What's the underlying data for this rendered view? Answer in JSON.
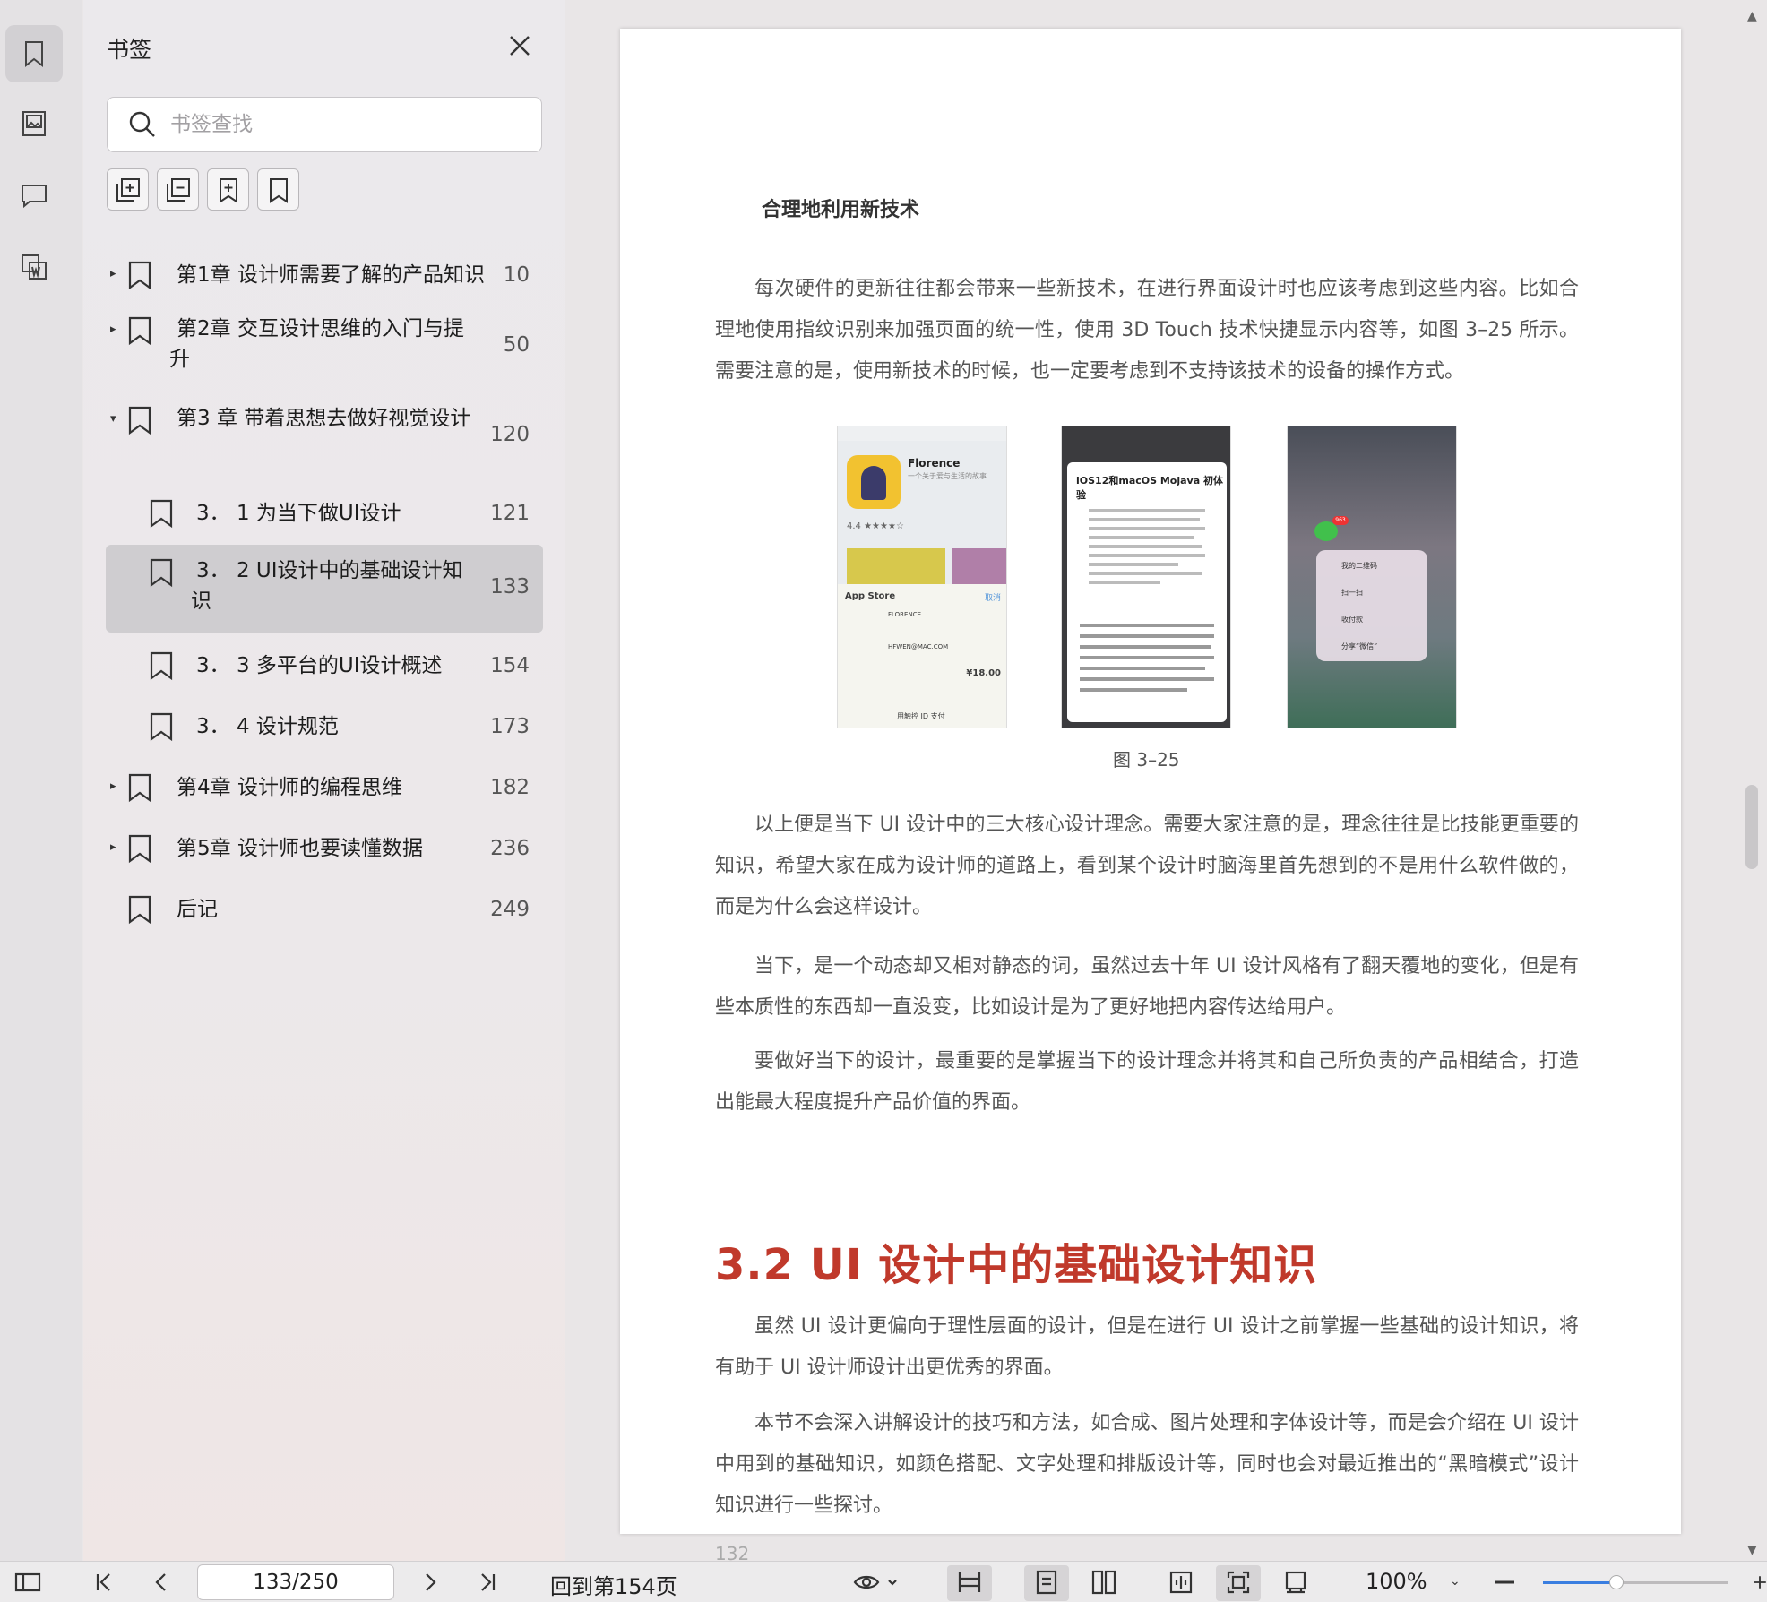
{
  "sidebar_panel": {
    "title": "书签",
    "search_placeholder": "书签查找",
    "bookmarks": [
      {
        "label": "第1章 设计师需要了解的产品知识",
        "page": "10",
        "level": 0,
        "arrow": "collapsed"
      },
      {
        "label": "第2章 交互设计思维的入门与提升",
        "page": "50",
        "level": 0,
        "arrow": "collapsed"
      },
      {
        "label": "第3 章 带着思想去做好视觉设计",
        "page": "120",
        "level": 0,
        "arrow": "expanded"
      },
      {
        "label": "3． 1 为当下做UI设计",
        "page": "121",
        "level": 1
      },
      {
        "label": "3． 2 UI设计中的基础设计知识",
        "page": "133",
        "level": 1,
        "selected": true
      },
      {
        "label": "3． 3 多平台的UI设计概述",
        "page": "154",
        "level": 1
      },
      {
        "label": "3． 4 设计规范",
        "page": "173",
        "level": 1
      },
      {
        "label": "第4章 设计师的编程思维",
        "page": "182",
        "level": 0,
        "arrow": "collapsed"
      },
      {
        "label": "第5章 设计师也要读懂数据",
        "page": "236",
        "level": 0,
        "arrow": "collapsed"
      },
      {
        "label": "后记",
        "page": "249",
        "level": 0
      }
    ]
  },
  "document": {
    "heading": "合理地利用新技术",
    "para1": "每次硬件的更新往往都会带来一些新技术，在进行界面设计时也应该考虑到这些内容。比如合理地使用指纹识别来加强页面的统一性，使用 3D Touch 技术快捷显示内容等，如图 3–25 所示。需要注意的是，使用新技术的时候，也一定要考虑到不支持该技术的设备的操作方式。",
    "figure_caption": "图 3–25",
    "para2": "以上便是当下 UI 设计中的三大核心设计理念。需要大家注意的是，理念往往是比技能更重要的知识，希望大家在成为设计师的道路上，看到某个设计时脑海里首先想到的不是用什么软件做的，而是为什么会这样设计。",
    "para3": "当下，是一个动态却又相对静态的词，虽然过去十年 UI 设计风格有了翻天覆地的变化，但是有些本质性的东西却一直没变，比如设计是为了更好地把内容传达给用户。",
    "para4": "要做好当下的设计，最重要的是掌握当下的设计理念并将其和自己所负责的产品相结合，打造出能最大程度提升产品价值的界面。",
    "section_title": "3.2   UI 设计中的基础设计知识",
    "para5": "虽然 UI 设计更偏向于理性层面的设计，但是在进行 UI 设计之前掌握一些基础的设计知识，将有助于 UI 设计师设计出更优秀的界面。",
    "para6": "本节不会深入讲解设计的技巧和方法，如合成、图片处理和字体设计等，而是会介绍在 UI 设计中用到的基础知识，如颜色搭配、文字处理和排版设计等，同时也会对最近推出的“黑暗模式”设计知识进行一些探讨。",
    "page_number": "132",
    "fig1": {
      "name": "Florence",
      "sub": "一个关于爱与生活的故事",
      "rating": "4.4 ★★★★☆",
      "sheet_title": "App Store",
      "sheet_cancel": "取消",
      "line1": "FLORENCE",
      "line2": "HFWEN@MAC.COM",
      "price": "¥18.00",
      "pay": "用触控 ID 支付"
    },
    "fig2": {
      "title": "iOS12和macOS Mojava 初体验"
    },
    "fig3": {
      "badge": "963",
      "items": [
        "我的二维码",
        "扫一扫",
        "收付款",
        "分享“微信”"
      ]
    }
  },
  "bottom_toolbar": {
    "page_input": "133/250",
    "back_link": "回到第154页",
    "zoom": "100%",
    "zoom_fraction": 0.4
  },
  "colors": {
    "accent_title": "#c0392b",
    "selection": "#cfcdd0",
    "slider": "#3a7ee0"
  }
}
